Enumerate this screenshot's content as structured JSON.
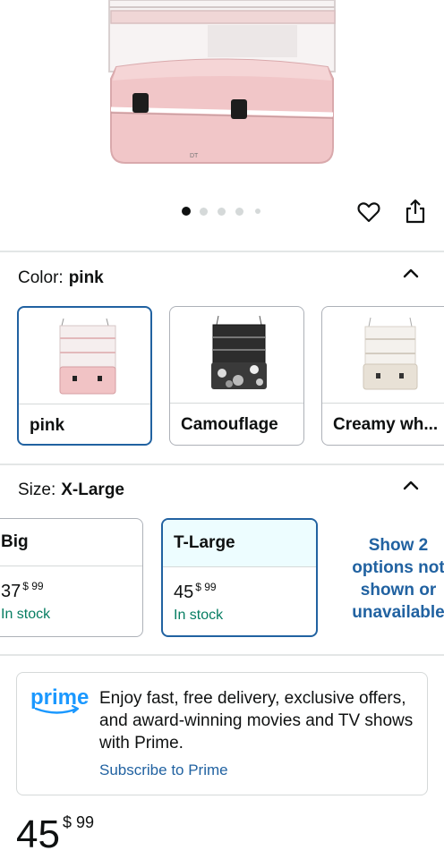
{
  "carousel": {
    "total": 5,
    "active_index": 0
  },
  "color_section": {
    "label": "Color:",
    "value": "pink",
    "options": [
      {
        "label": "pink",
        "selected": true,
        "swatch": "#f2c9c9"
      },
      {
        "label": "Camouflage",
        "selected": false,
        "swatch": "#2b2b2b"
      },
      {
        "label": "Creamy wh...",
        "selected": false,
        "swatch": "#ece6dc"
      }
    ]
  },
  "size_section": {
    "label": "Size:",
    "value": "X-Large",
    "options": [
      {
        "name": "Big",
        "price_whole": "37",
        "price_fraction": "$ 99",
        "stock": "In stock",
        "selected": false
      },
      {
        "name": "T-Large",
        "price_whole": "45",
        "price_fraction": "$ 99",
        "stock": "In stock",
        "selected": true
      }
    ],
    "more_options": "Show 2 options not shown or unavailable"
  },
  "prime": {
    "logo_text": "prime",
    "message": "Enjoy fast, free delivery, exclusive offers, and award-winning movies and TV shows with Prime.",
    "link": "Subscribe to Prime"
  },
  "price": {
    "whole": "45",
    "fraction": "$ 99"
  },
  "colors": {
    "accent": "#2162a1",
    "stock_green": "#067d62",
    "border": "#adb1b8"
  }
}
